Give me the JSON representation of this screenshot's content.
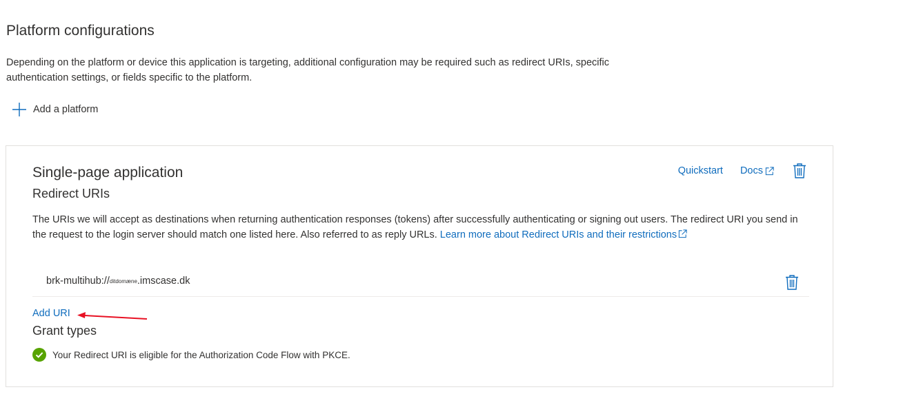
{
  "page": {
    "title": "Platform configurations",
    "description": "Depending on the platform or device this application is targeting, additional configuration may be required such as redirect URIs, specific authentication settings, or fields specific to the platform.",
    "add_platform_label": "Add a platform"
  },
  "platform_card": {
    "title": "Single-page application",
    "quickstart_label": "Quickstart",
    "docs_label": "Docs",
    "redirect_uris": {
      "heading": "Redirect URIs",
      "description": "The URIs we will accept as destinations when returning authentication responses (tokens) after successfully authenticating or signing out users. The redirect URI you send in the request to the login server should match one listed here. Also referred to as reply URLs. ",
      "learn_more_label": "Learn more about Redirect URIs and their restrictions",
      "items": [
        {
          "prefix": "brk-multihub://",
          "redacted": "ditdomæne",
          "suffix": ".imscase.dk"
        }
      ],
      "add_uri_label": "Add URI"
    },
    "grant_types": {
      "heading": "Grant types",
      "eligibility_text": "Your Redirect URI is eligible for the Authorization Code Flow with PKCE."
    }
  },
  "colors": {
    "link": "#0f6cbd",
    "text": "#323130",
    "success": "#57a300",
    "annotation_arrow": "#e81123"
  },
  "icons": [
    "plus-icon",
    "external-link-icon",
    "trash-icon",
    "checkmark-circle-icon",
    "red-arrow-annotation"
  ]
}
